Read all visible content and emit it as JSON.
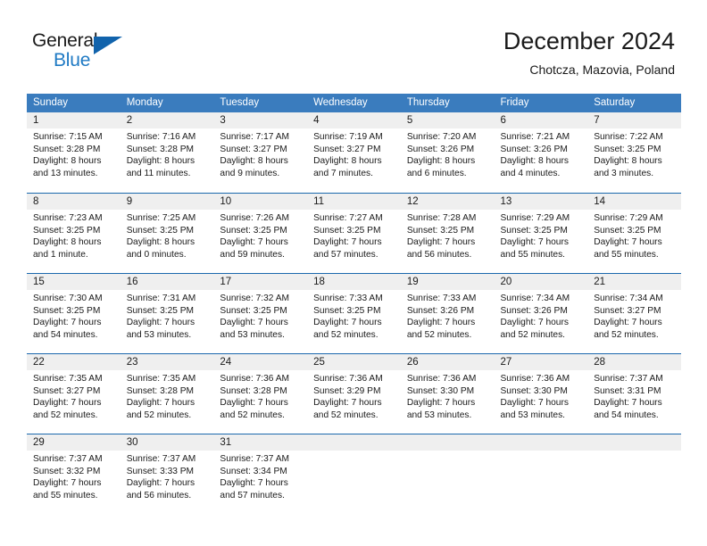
{
  "brand": {
    "name_part1": "General",
    "name_part2": "Blue",
    "flag_icon": "triangle-flag-icon"
  },
  "header": {
    "title": "December 2024",
    "subtitle": "Chotcza, Mazovia, Poland"
  },
  "calendar": {
    "weekday_headers": [
      "Sunday",
      "Monday",
      "Tuesday",
      "Wednesday",
      "Thursday",
      "Friday",
      "Saturday"
    ],
    "accent_color": "#3a7cbe",
    "border_color": "#1b68ad",
    "date_band_color": "#efefef",
    "weeks": [
      [
        {
          "date": "1",
          "sunrise": "Sunrise: 7:15 AM",
          "sunset": "Sunset: 3:28 PM",
          "daylight_line1": "Daylight: 8 hours",
          "daylight_line2": "and 13 minutes."
        },
        {
          "date": "2",
          "sunrise": "Sunrise: 7:16 AM",
          "sunset": "Sunset: 3:28 PM",
          "daylight_line1": "Daylight: 8 hours",
          "daylight_line2": "and 11 minutes."
        },
        {
          "date": "3",
          "sunrise": "Sunrise: 7:17 AM",
          "sunset": "Sunset: 3:27 PM",
          "daylight_line1": "Daylight: 8 hours",
          "daylight_line2": "and 9 minutes."
        },
        {
          "date": "4",
          "sunrise": "Sunrise: 7:19 AM",
          "sunset": "Sunset: 3:27 PM",
          "daylight_line1": "Daylight: 8 hours",
          "daylight_line2": "and 7 minutes."
        },
        {
          "date": "5",
          "sunrise": "Sunrise: 7:20 AM",
          "sunset": "Sunset: 3:26 PM",
          "daylight_line1": "Daylight: 8 hours",
          "daylight_line2": "and 6 minutes."
        },
        {
          "date": "6",
          "sunrise": "Sunrise: 7:21 AM",
          "sunset": "Sunset: 3:26 PM",
          "daylight_line1": "Daylight: 8 hours",
          "daylight_line2": "and 4 minutes."
        },
        {
          "date": "7",
          "sunrise": "Sunrise: 7:22 AM",
          "sunset": "Sunset: 3:25 PM",
          "daylight_line1": "Daylight: 8 hours",
          "daylight_line2": "and 3 minutes."
        }
      ],
      [
        {
          "date": "8",
          "sunrise": "Sunrise: 7:23 AM",
          "sunset": "Sunset: 3:25 PM",
          "daylight_line1": "Daylight: 8 hours",
          "daylight_line2": "and 1 minute."
        },
        {
          "date": "9",
          "sunrise": "Sunrise: 7:25 AM",
          "sunset": "Sunset: 3:25 PM",
          "daylight_line1": "Daylight: 8 hours",
          "daylight_line2": "and 0 minutes."
        },
        {
          "date": "10",
          "sunrise": "Sunrise: 7:26 AM",
          "sunset": "Sunset: 3:25 PM",
          "daylight_line1": "Daylight: 7 hours",
          "daylight_line2": "and 59 minutes."
        },
        {
          "date": "11",
          "sunrise": "Sunrise: 7:27 AM",
          "sunset": "Sunset: 3:25 PM",
          "daylight_line1": "Daylight: 7 hours",
          "daylight_line2": "and 57 minutes."
        },
        {
          "date": "12",
          "sunrise": "Sunrise: 7:28 AM",
          "sunset": "Sunset: 3:25 PM",
          "daylight_line1": "Daylight: 7 hours",
          "daylight_line2": "and 56 minutes."
        },
        {
          "date": "13",
          "sunrise": "Sunrise: 7:29 AM",
          "sunset": "Sunset: 3:25 PM",
          "daylight_line1": "Daylight: 7 hours",
          "daylight_line2": "and 55 minutes."
        },
        {
          "date": "14",
          "sunrise": "Sunrise: 7:29 AM",
          "sunset": "Sunset: 3:25 PM",
          "daylight_line1": "Daylight: 7 hours",
          "daylight_line2": "and 55 minutes."
        }
      ],
      [
        {
          "date": "15",
          "sunrise": "Sunrise: 7:30 AM",
          "sunset": "Sunset: 3:25 PM",
          "daylight_line1": "Daylight: 7 hours",
          "daylight_line2": "and 54 minutes."
        },
        {
          "date": "16",
          "sunrise": "Sunrise: 7:31 AM",
          "sunset": "Sunset: 3:25 PM",
          "daylight_line1": "Daylight: 7 hours",
          "daylight_line2": "and 53 minutes."
        },
        {
          "date": "17",
          "sunrise": "Sunrise: 7:32 AM",
          "sunset": "Sunset: 3:25 PM",
          "daylight_line1": "Daylight: 7 hours",
          "daylight_line2": "and 53 minutes."
        },
        {
          "date": "18",
          "sunrise": "Sunrise: 7:33 AM",
          "sunset": "Sunset: 3:25 PM",
          "daylight_line1": "Daylight: 7 hours",
          "daylight_line2": "and 52 minutes."
        },
        {
          "date": "19",
          "sunrise": "Sunrise: 7:33 AM",
          "sunset": "Sunset: 3:26 PM",
          "daylight_line1": "Daylight: 7 hours",
          "daylight_line2": "and 52 minutes."
        },
        {
          "date": "20",
          "sunrise": "Sunrise: 7:34 AM",
          "sunset": "Sunset: 3:26 PM",
          "daylight_line1": "Daylight: 7 hours",
          "daylight_line2": "and 52 minutes."
        },
        {
          "date": "21",
          "sunrise": "Sunrise: 7:34 AM",
          "sunset": "Sunset: 3:27 PM",
          "daylight_line1": "Daylight: 7 hours",
          "daylight_line2": "and 52 minutes."
        }
      ],
      [
        {
          "date": "22",
          "sunrise": "Sunrise: 7:35 AM",
          "sunset": "Sunset: 3:27 PM",
          "daylight_line1": "Daylight: 7 hours",
          "daylight_line2": "and 52 minutes."
        },
        {
          "date": "23",
          "sunrise": "Sunrise: 7:35 AM",
          "sunset": "Sunset: 3:28 PM",
          "daylight_line1": "Daylight: 7 hours",
          "daylight_line2": "and 52 minutes."
        },
        {
          "date": "24",
          "sunrise": "Sunrise: 7:36 AM",
          "sunset": "Sunset: 3:28 PM",
          "daylight_line1": "Daylight: 7 hours",
          "daylight_line2": "and 52 minutes."
        },
        {
          "date": "25",
          "sunrise": "Sunrise: 7:36 AM",
          "sunset": "Sunset: 3:29 PM",
          "daylight_line1": "Daylight: 7 hours",
          "daylight_line2": "and 52 minutes."
        },
        {
          "date": "26",
          "sunrise": "Sunrise: 7:36 AM",
          "sunset": "Sunset: 3:30 PM",
          "daylight_line1": "Daylight: 7 hours",
          "daylight_line2": "and 53 minutes."
        },
        {
          "date": "27",
          "sunrise": "Sunrise: 7:36 AM",
          "sunset": "Sunset: 3:30 PM",
          "daylight_line1": "Daylight: 7 hours",
          "daylight_line2": "and 53 minutes."
        },
        {
          "date": "28",
          "sunrise": "Sunrise: 7:37 AM",
          "sunset": "Sunset: 3:31 PM",
          "daylight_line1": "Daylight: 7 hours",
          "daylight_line2": "and 54 minutes."
        }
      ],
      [
        {
          "date": "29",
          "sunrise": "Sunrise: 7:37 AM",
          "sunset": "Sunset: 3:32 PM",
          "daylight_line1": "Daylight: 7 hours",
          "daylight_line2": "and 55 minutes."
        },
        {
          "date": "30",
          "sunrise": "Sunrise: 7:37 AM",
          "sunset": "Sunset: 3:33 PM",
          "daylight_line1": "Daylight: 7 hours",
          "daylight_line2": "and 56 minutes."
        },
        {
          "date": "31",
          "sunrise": "Sunrise: 7:37 AM",
          "sunset": "Sunset: 3:34 PM",
          "daylight_line1": "Daylight: 7 hours",
          "daylight_line2": "and 57 minutes."
        },
        {
          "date": "",
          "sunrise": "",
          "sunset": "",
          "daylight_line1": "",
          "daylight_line2": ""
        },
        {
          "date": "",
          "sunrise": "",
          "sunset": "",
          "daylight_line1": "",
          "daylight_line2": ""
        },
        {
          "date": "",
          "sunrise": "",
          "sunset": "",
          "daylight_line1": "",
          "daylight_line2": ""
        },
        {
          "date": "",
          "sunrise": "",
          "sunset": "",
          "daylight_line1": "",
          "daylight_line2": ""
        }
      ]
    ]
  }
}
